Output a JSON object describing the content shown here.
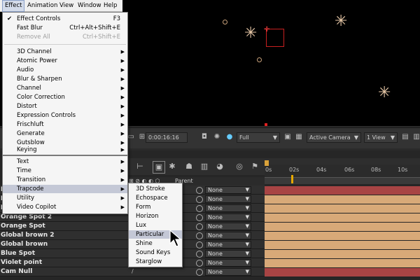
{
  "menubar": {
    "items": [
      "Effect",
      "Animation",
      "View",
      "Window",
      "Help"
    ],
    "active": "Effect"
  },
  "effect_menu": {
    "top_items": [
      {
        "label": "Effect Controls",
        "shortcut": "F3",
        "checked": true
      },
      {
        "label": "Fast Blur",
        "shortcut": "Ctrl+Alt+Shift+E"
      },
      {
        "label": "Remove All",
        "shortcut": "Ctrl+Shift+E",
        "disabled": true
      }
    ],
    "categories": [
      "3D Channel",
      "Atomic Power",
      "Audio",
      "Blur & Sharpen",
      "Channel",
      "Color Correction",
      "Distort",
      "Expression Controls",
      "Frischluft",
      "Generate",
      "Gutsblow",
      "Keying",
      "Text",
      "Time",
      "Transition",
      "Trapcode",
      "Utility",
      "Video Copilot"
    ],
    "highlighted": "Trapcode"
  },
  "trapcode_submenu": {
    "items": [
      "3D Stroke",
      "Echospace",
      "Form",
      "Horizon",
      "Lux",
      "Particular",
      "Shine",
      "Sound Keys",
      "Starglow"
    ],
    "highlighted": "Particular"
  },
  "viewer_bar": {
    "timecode": "0:00:16:16",
    "resolution": "Full",
    "camera": "Active Camera",
    "views": "1 View"
  },
  "timeline": {
    "ruler_ticks": [
      "0s",
      "02s",
      "04s",
      "06s",
      "08s",
      "10s"
    ],
    "parent_header": "Parent",
    "layers": [
      {
        "name": "Pa",
        "parent": "None"
      },
      {
        "name": "Da",
        "parent": "None"
      },
      {
        "name": "Da",
        "parent": "None"
      },
      {
        "name": "Orange Spot 2",
        "parent": "None"
      },
      {
        "name": "Orange Spot",
        "parent": "None"
      },
      {
        "name": "Global brown 2",
        "parent": "None"
      },
      {
        "name": "Global brown",
        "parent": "None"
      },
      {
        "name": "Blue Spot",
        "parent": "None"
      },
      {
        "name": "Violet point",
        "parent": "None"
      },
      {
        "name": "Cam Null",
        "parent": "None"
      }
    ]
  },
  "colors": {
    "viewer_bg": "#000000",
    "layer_bar": "#d9aa7a",
    "layer_bar_red": "#a84444",
    "menu_highlight": "#c4c8d6"
  },
  "icons": [
    "sparkle-icon",
    "camera-icon",
    "color-picker-icon",
    "mouse-cursor-icon"
  ]
}
